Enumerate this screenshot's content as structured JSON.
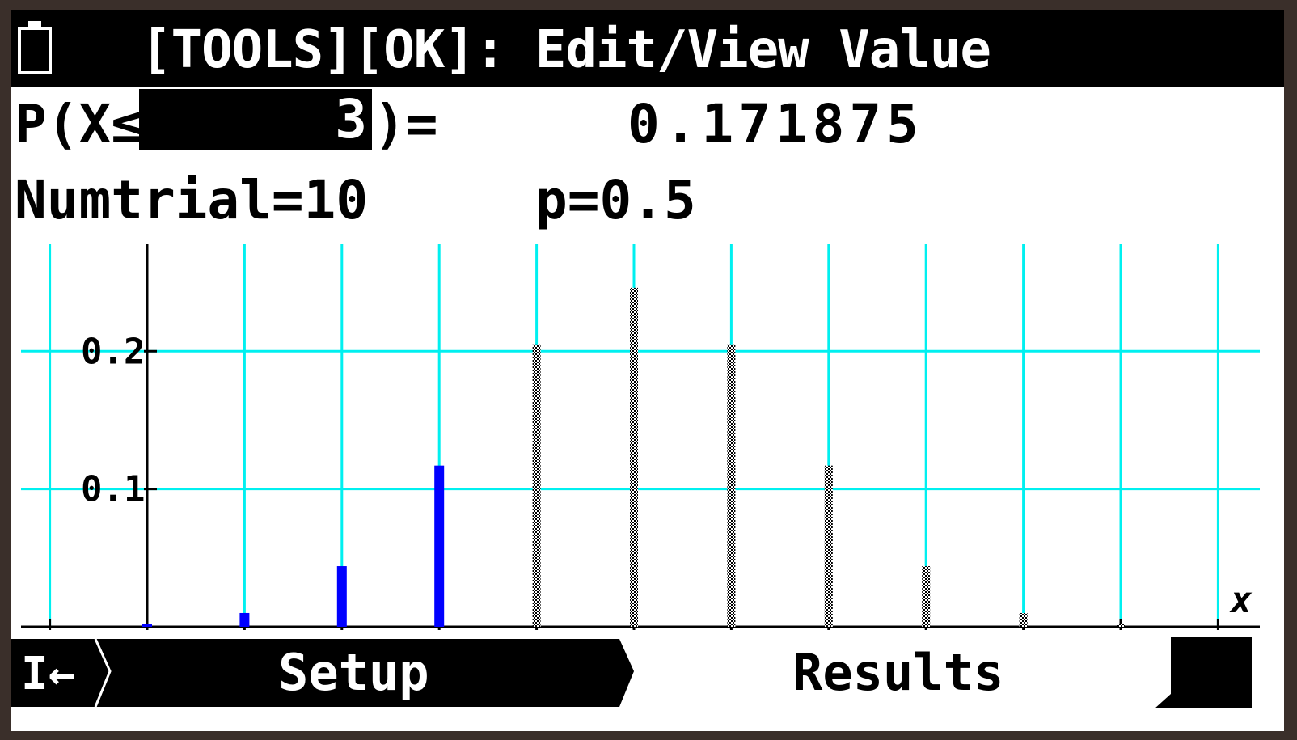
{
  "header": {
    "title": "[TOOLS][OK]: Edit/View Value",
    "battery_icon": "battery-icon"
  },
  "calc": {
    "prob_prefix": "P(X≤",
    "input_value": "3",
    "prob_suffix": ")=",
    "result": "0.171875",
    "numtrial": "Numtrial=10",
    "p": "p=0.5"
  },
  "chart_data": {
    "type": "bar",
    "x": [
      0,
      1,
      2,
      3,
      4,
      5,
      6,
      7,
      8,
      9,
      10
    ],
    "values": [
      0.001,
      0.01,
      0.044,
      0.117,
      0.205,
      0.246,
      0.205,
      0.117,
      0.044,
      0.01,
      0.001
    ],
    "highlighted_through_x": 3,
    "y_tick_labels": [
      "0.1",
      "0.2"
    ],
    "y_ticks": [
      0.1,
      0.2
    ],
    "xlabel": "x",
    "ylabel": "",
    "ylim": [
      0,
      0.27
    ],
    "grid": true,
    "colors": {
      "grid": "#00f0f0",
      "highlight": "#0000ff",
      "bar": "#000000",
      "axis": "#000000"
    }
  },
  "footer": {
    "back_label": "I←",
    "tab_setup": "Setup",
    "tab_results": "Results"
  }
}
